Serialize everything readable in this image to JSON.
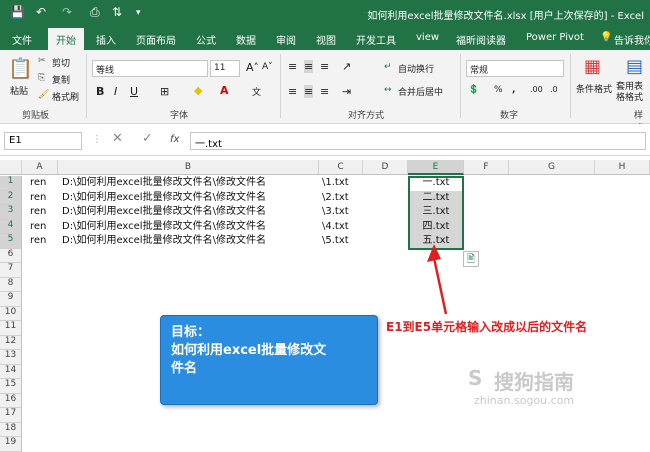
{
  "titlebar": {
    "title": "如何利用excel批量修改文件名.xlsx [用户上次保存的] - Excel",
    "qa_icons": [
      "save-icon",
      "undo-icon",
      "redo-icon",
      "print-preview-icon",
      "sort-icon",
      "customize-icon"
    ]
  },
  "tabs": [
    "文件",
    "开始",
    "插入",
    "页面布局",
    "公式",
    "数据",
    "审阅",
    "视图",
    "开发工具",
    "view",
    "福昕阅读器",
    "Power Pivot",
    "告诉我你"
  ],
  "active_tab": "开始",
  "ribbon": {
    "paste": "粘贴",
    "cut": "剪切",
    "copy": "复制",
    "format_painter": "格式刷",
    "clipboard_label": "剪贴板",
    "font_name": "等线",
    "font_size": "11",
    "font_label": "字体",
    "bold": "B",
    "italic": "I",
    "underline": "U",
    "wrap_text": "自动换行",
    "merge_center": "合并后居中",
    "align_label": "对齐方式",
    "number_format": "常规",
    "number_label": "数字",
    "cond_format": "条件格式",
    "table_format": "套用表格格式",
    "styles_label": "样式"
  },
  "formula": {
    "cell_ref": "E1",
    "fx": "fx",
    "value": "一.txt"
  },
  "columns": [
    "A",
    "B",
    "C",
    "D",
    "E",
    "F",
    "G",
    "H"
  ],
  "rows": [
    "1",
    "2",
    "3",
    "4",
    "5",
    "6",
    "7",
    "8",
    "9",
    "10",
    "11",
    "12",
    "13",
    "14",
    "15",
    "16",
    "17",
    "18",
    "19"
  ],
  "cells": {
    "A": [
      "ren",
      "ren",
      "ren",
      "ren",
      "ren"
    ],
    "B": [
      "D:\\如何利用excel批量修改文件名\\修改文件名",
      "D:\\如何利用excel批量修改文件名\\修改文件名",
      "D:\\如何利用excel批量修改文件名\\修改文件名",
      "D:\\如何利用excel批量修改文件名\\修改文件名",
      "D:\\如何利用excel批量修改文件名\\修改文件名"
    ],
    "C": [
      "\\1.txt",
      "\\2.txt",
      "\\3.txt",
      "\\4.txt",
      "\\5.txt"
    ],
    "E": [
      "一.txt",
      "二.txt",
      "三.txt",
      "四.txt",
      "五.txt"
    ]
  },
  "annotation": "E1到E5单元格输入改成以后的文件名",
  "callout": {
    "line1": "目标：",
    "line2": "如何利用excel批量修改文",
    "line3": "件名"
  },
  "watermark": {
    "text": "搜狗指南",
    "url": "zhinan.sogou.com"
  },
  "colors": {
    "excel_green": "#217346",
    "callout_blue": "#2a8de0",
    "annotation_red": "#e02020"
  }
}
